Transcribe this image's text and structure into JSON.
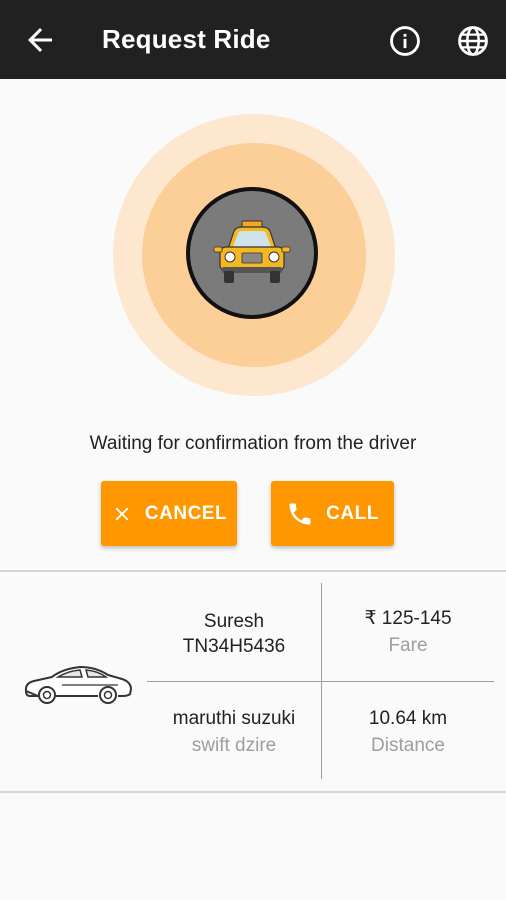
{
  "appbar": {
    "title": "Request Ride",
    "back_icon": "arrow-back-icon",
    "info_icon": "info-icon",
    "language_icon": "globe-icon",
    "background": "#212121"
  },
  "status": {
    "message": "Waiting for confirmation from the driver",
    "pulse_colors": [
      "#fde7cf",
      "#fdcf98"
    ],
    "center_icon": "taxi-icon"
  },
  "actions": {
    "cancel_label": "CANCEL",
    "call_label": "CALL",
    "accent": "#ff9800"
  },
  "driver": {
    "name": "Suresh",
    "vehicle_number": "TN34H5436",
    "car_make": "maruthi suzuki",
    "car_model": "swift dzire",
    "car_icon": "car-icon"
  },
  "fare": {
    "value": "₹ 125-145",
    "label": "Fare"
  },
  "distance": {
    "value": "10.64 km",
    "label": "Distance"
  }
}
